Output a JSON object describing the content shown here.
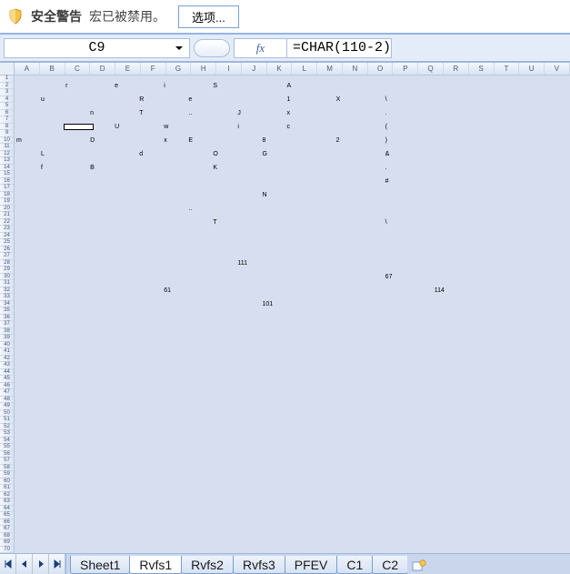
{
  "security": {
    "title": "安全警告",
    "message": "宏已被禁用。",
    "options_label": "选项..."
  },
  "formula_bar": {
    "cell_ref": "C9",
    "fx_label": "fx",
    "formula": "=CHAR(110-2)"
  },
  "columns": [
    "A",
    "B",
    "C",
    "D",
    "E",
    "F",
    "G",
    "H",
    "I",
    "J",
    "K",
    "L",
    "M",
    "N",
    "O",
    "P",
    "Q",
    "R",
    "S",
    "T",
    "U",
    "V"
  ],
  "row_start": 1,
  "row_end": 70,
  "active_cell": {
    "col": 2,
    "row": 8
  },
  "cells": [
    {
      "c": 2,
      "r": 2,
      "v": "r"
    },
    {
      "c": 4,
      "r": 2,
      "v": "e"
    },
    {
      "c": 6,
      "r": 2,
      "v": "i"
    },
    {
      "c": 8,
      "r": 2,
      "v": "S"
    },
    {
      "c": 11,
      "r": 2,
      "v": "A"
    },
    {
      "c": 1,
      "r": 4,
      "v": "u"
    },
    {
      "c": 5,
      "r": 4,
      "v": "R"
    },
    {
      "c": 7,
      "r": 4,
      "v": "e"
    },
    {
      "c": 11,
      "r": 4,
      "v": "1"
    },
    {
      "c": 13,
      "r": 4,
      "v": "X"
    },
    {
      "c": 15,
      "r": 4,
      "v": "\\"
    },
    {
      "c": 3,
      "r": 6,
      "v": "n"
    },
    {
      "c": 5,
      "r": 6,
      "v": "T"
    },
    {
      "c": 7,
      "r": 6,
      "v": ".."
    },
    {
      "c": 9,
      "r": 6,
      "v": "J"
    },
    {
      "c": 11,
      "r": 6,
      "v": "x"
    },
    {
      "c": 15,
      "r": 6,
      "v": "."
    },
    {
      "c": 2,
      "r": 8,
      "v": ""
    },
    {
      "c": 4,
      "r": 8,
      "v": "U"
    },
    {
      "c": 6,
      "r": 8,
      "v": "w"
    },
    {
      "c": 9,
      "r": 8,
      "v": "i"
    },
    {
      "c": 11,
      "r": 8,
      "v": "c"
    },
    {
      "c": 15,
      "r": 8,
      "v": "("
    },
    {
      "c": 0,
      "r": 10,
      "v": "m"
    },
    {
      "c": 3,
      "r": 10,
      "v": "D"
    },
    {
      "c": 6,
      "r": 10,
      "v": "x"
    },
    {
      "c": 7,
      "r": 10,
      "v": "E"
    },
    {
      "c": 10,
      "r": 10,
      "v": "8"
    },
    {
      "c": 13,
      "r": 10,
      "v": "2"
    },
    {
      "c": 15,
      "r": 10,
      "v": ")"
    },
    {
      "c": 1,
      "r": 12,
      "v": "L"
    },
    {
      "c": 5,
      "r": 12,
      "v": "d"
    },
    {
      "c": 8,
      "r": 12,
      "v": "O"
    },
    {
      "c": 10,
      "r": 12,
      "v": "G"
    },
    {
      "c": 15,
      "r": 12,
      "v": "&"
    },
    {
      "c": 1,
      "r": 14,
      "v": "f"
    },
    {
      "c": 3,
      "r": 14,
      "v": "B"
    },
    {
      "c": 8,
      "r": 14,
      "v": "K"
    },
    {
      "c": 15,
      "r": 14,
      "v": "."
    },
    {
      "c": 15,
      "r": 16,
      "v": "#"
    },
    {
      "c": 10,
      "r": 18,
      "v": "N"
    },
    {
      "c": 7,
      "r": 20,
      "v": ".."
    },
    {
      "c": 8,
      "r": 22,
      "v": "T"
    },
    {
      "c": 15,
      "r": 22,
      "v": "\\"
    },
    {
      "c": 9,
      "r": 28,
      "v": "111"
    },
    {
      "c": 15,
      "r": 30,
      "v": "67"
    },
    {
      "c": 6,
      "r": 32,
      "v": "61"
    },
    {
      "c": 17,
      "r": 32,
      "v": "114"
    },
    {
      "c": 10,
      "r": 34,
      "v": "101"
    }
  ],
  "tabs": {
    "items": [
      "Sheet1",
      "Rvfs1",
      "Rvfs2",
      "Rvfs3",
      "PFEV",
      "С1",
      "С2"
    ],
    "active_index": 1
  }
}
